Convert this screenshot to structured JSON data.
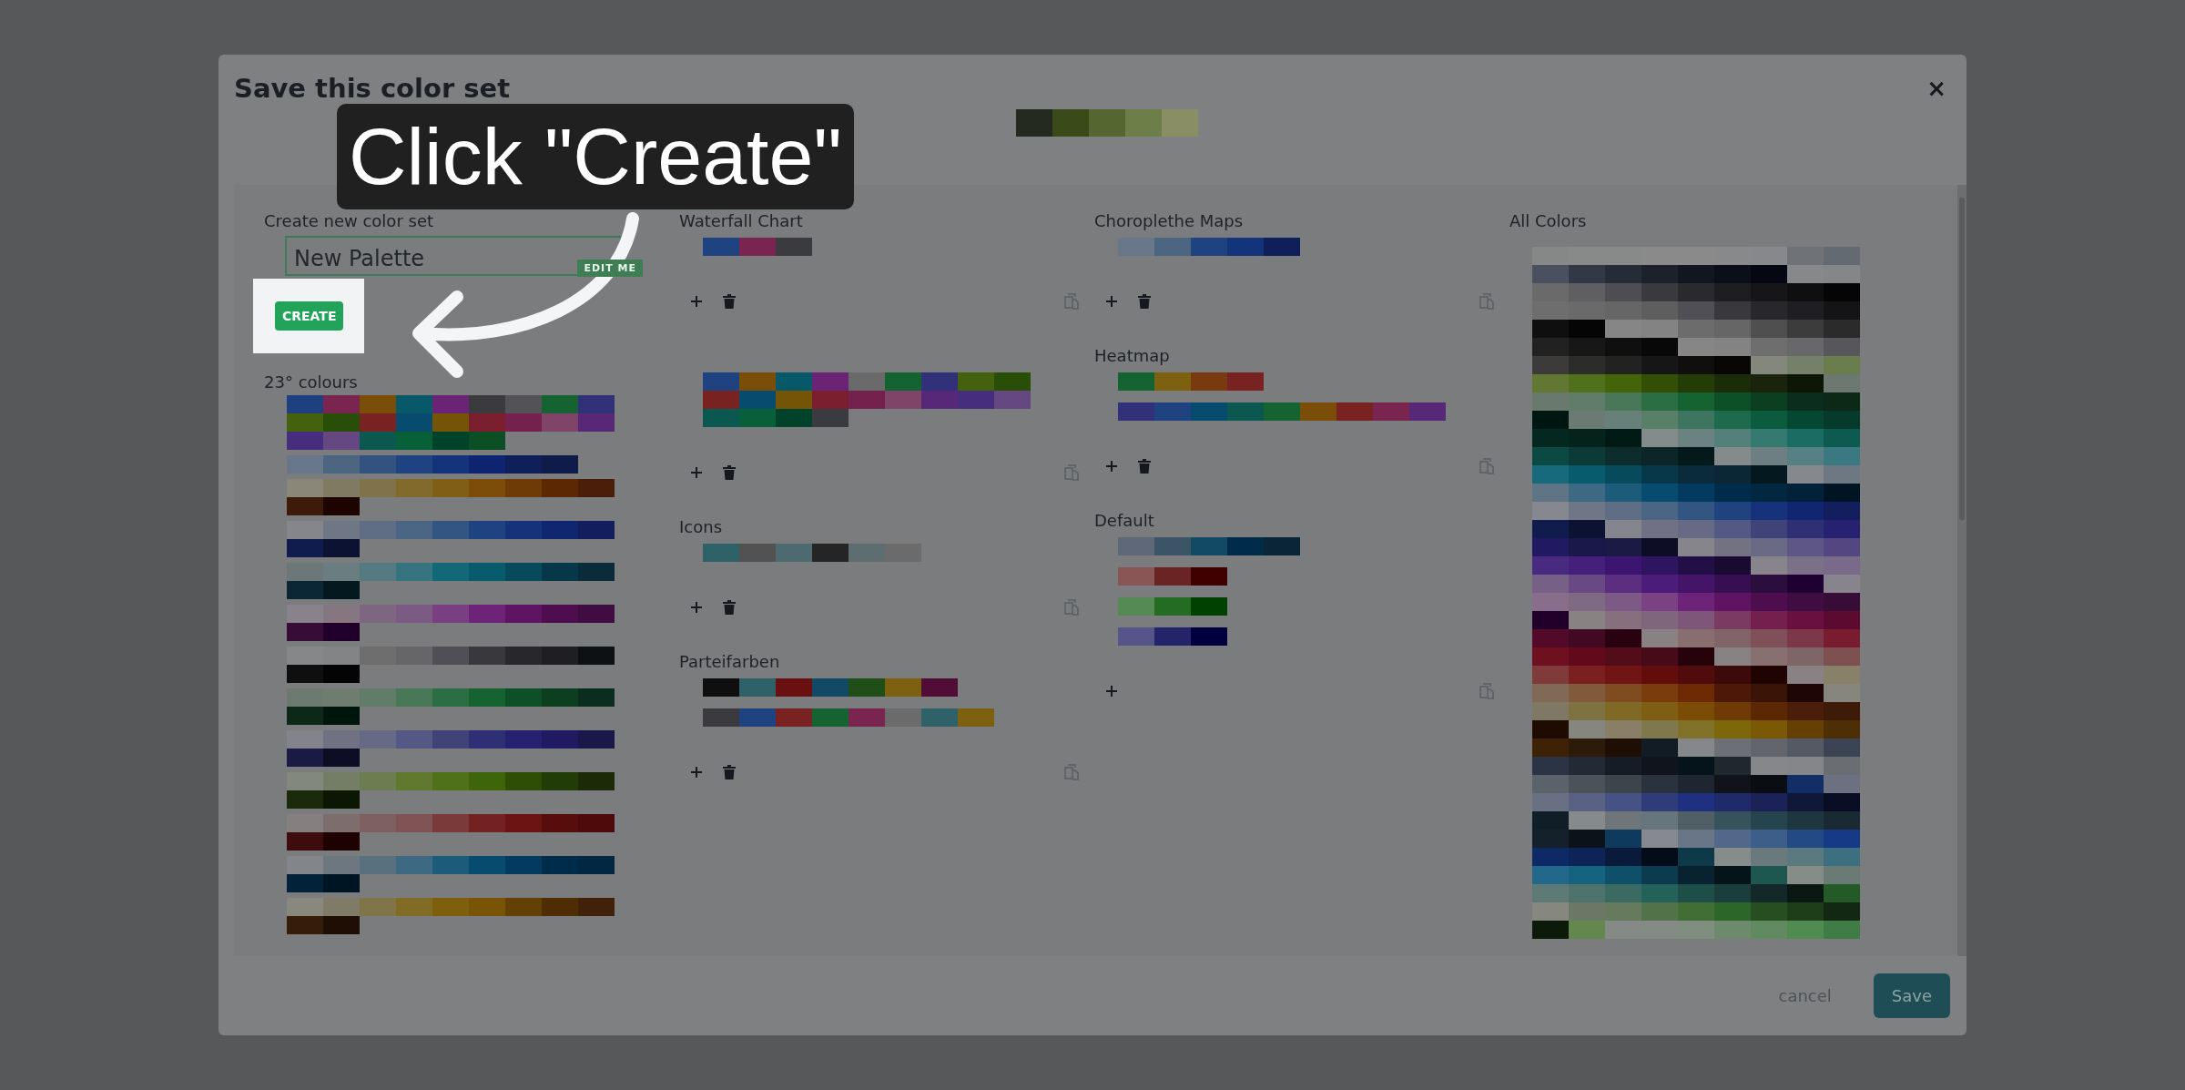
{
  "dialog": {
    "title": "Save this color set",
    "close": "×",
    "preview": [
      {
        "color": "#252a20"
      },
      {
        "color": "#3a4a18"
      },
      {
        "color": "#566630"
      },
      {
        "color": "#6e7e48"
      },
      {
        "color": "#8a8e64"
      }
    ]
  },
  "callout": {
    "text": "Click \"Create\""
  },
  "create_panel": {
    "label": "Create new color set",
    "name_value": "New Palette",
    "edit_tag": "EDIT ME",
    "create_button": "CREATE"
  },
  "preset_groups": {
    "title": "23° colours",
    "palettes": [
      [
        {
          "color": "#1f4080"
        },
        {
          "color": "#7a2450"
        },
        {
          "color": "#7a4e08"
        },
        {
          "color": "#075868"
        },
        {
          "color": "#6b2376"
        },
        {
          "color": "#3b3a3f"
        },
        {
          "color": "#525257"
        },
        {
          "color": "#146330"
        },
        {
          "color": "#31317a"
        },
        {
          "color": "#44620e"
        },
        {
          "color": "#284e07"
        },
        {
          "color": "#792222"
        },
        {
          "color": "#074b6f"
        },
        {
          "color": "#745507"
        },
        {
          "color": "#7b1f2e"
        },
        {
          "color": "#75214d"
        },
        {
          "color": "#804468"
        },
        {
          "color": "#572878"
        },
        {
          "color": "#472d7d"
        },
        {
          "color": "#654882"
        },
        {
          "color": "#0a5850"
        },
        {
          "color": "#086038"
        },
        {
          "color": "#00432a"
        },
        {
          "color": "#0c4f25"
        }
      ],
      [
        {
          "color": "#687789"
        },
        {
          "color": "#4c6581"
        },
        {
          "color": "#325280"
        },
        {
          "color": "#1f4381"
        },
        {
          "color": "#13337b"
        },
        {
          "color": "#0f2470"
        },
        {
          "color": "#0f1f5a"
        },
        {
          "color": "#0f1b48"
        }
      ],
      [
        {
          "color": "#8a8779"
        },
        {
          "color": "#7f7a62"
        },
        {
          "color": "#80734a"
        },
        {
          "color": "#816a2c"
        },
        {
          "color": "#7f5f16"
        },
        {
          "color": "#7c4d08"
        },
        {
          "color": "#6e3a06"
        },
        {
          "color": "#5c2804"
        },
        {
          "color": "#4a1e08"
        },
        {
          "color": "#3e1a08"
        },
        {
          "color": "#1e0400"
        }
      ],
      [
        {
          "color": "#84868c"
        },
        {
          "color": "#6f7786"
        },
        {
          "color": "#5f6e85"
        },
        {
          "color": "#4b6585"
        },
        {
          "color": "#335581"
        },
        {
          "color": "#1f4381"
        },
        {
          "color": "#15327b"
        },
        {
          "color": "#102670"
        },
        {
          "color": "#121e5e"
        },
        {
          "color": "#0f1c4d"
        },
        {
          "color": "#0c1231"
        }
      ],
      [
        {
          "color": "#6c7878"
        },
        {
          "color": "#6a7d80"
        },
        {
          "color": "#537b81"
        },
        {
          "color": "#367580"
        },
        {
          "color": "#136877"
        },
        {
          "color": "#075b6c"
        },
        {
          "color": "#064a5b"
        },
        {
          "color": "#07384a"
        },
        {
          "color": "#0a2b3a"
        },
        {
          "color": "#0b2635"
        },
        {
          "color": "#041820"
        }
      ],
      [
        {
          "color": "#87828c"
        },
        {
          "color": "#86767f"
        },
        {
          "color": "#7f6680"
        },
        {
          "color": "#7b5a84"
        },
        {
          "color": "#793f80"
        },
        {
          "color": "#6d2378"
        },
        {
          "color": "#5e1463"
        },
        {
          "color": "#4d0d4f"
        },
        {
          "color": "#3f0d41"
        },
        {
          "color": "#370c37"
        },
        {
          "color": "#20002a"
        }
      ],
      [
        {
          "color": "#868788"
        },
        {
          "color": "#838485"
        },
        {
          "color": "#6e6e6e"
        },
        {
          "color": "#666668"
        },
        {
          "color": "#4f4f55"
        },
        {
          "color": "#38383d"
        },
        {
          "color": "#28282c"
        },
        {
          "color": "#1f1f23"
        },
        {
          "color": "#0e1114"
        },
        {
          "color": "#0f0f0f"
        },
        {
          "color": "#040404"
        }
      ],
      [
        {
          "color": "#6c7a70"
        },
        {
          "color": "#6f7d70"
        },
        {
          "color": "#617d6a"
        },
        {
          "color": "#487858"
        },
        {
          "color": "#2b6e44"
        },
        {
          "color": "#146330"
        },
        {
          "color": "#0d4f26"
        },
        {
          "color": "#0c3f1f"
        },
        {
          "color": "#0b2d1d"
        },
        {
          "color": "#0c2816"
        },
        {
          "color": "#00160c"
        }
      ],
      [
        {
          "color": "#83838b"
        },
        {
          "color": "#707283"
        },
        {
          "color": "#666a85"
        },
        {
          "color": "#535984"
        },
        {
          "color": "#3f4378"
        },
        {
          "color": "#2f2f75"
        },
        {
          "color": "#262170"
        },
        {
          "color": "#211a63"
        },
        {
          "color": "#1a184a"
        },
        {
          "color": "#1a1a45"
        },
        {
          "color": "#0d0e26"
        }
      ],
      [
        {
          "color": "#83887e"
        },
        {
          "color": "#747e66"
        },
        {
          "color": "#6c7d51"
        },
        {
          "color": "#61792f"
        },
        {
          "color": "#4f7119"
        },
        {
          "color": "#3e6509"
        },
        {
          "color": "#2f4e05"
        },
        {
          "color": "#213c06"
        },
        {
          "color": "#1c2a07"
        },
        {
          "color": "#1c2a0c"
        },
        {
          "color": "#0c1703"
        }
      ],
      [
        {
          "color": "#867f7f"
        },
        {
          "color": "#7e6d6d"
        },
        {
          "color": "#7e6060"
        },
        {
          "color": "#805454"
        },
        {
          "color": "#7b3a3a"
        },
        {
          "color": "#742121"
        },
        {
          "color": "#6b1414"
        },
        {
          "color": "#580d0d"
        },
        {
          "color": "#4e0a0a"
        },
        {
          "color": "#3e0c0c"
        },
        {
          "color": "#1e0202"
        }
      ],
      [
        {
          "color": "#82868a"
        },
        {
          "color": "#6d7780"
        },
        {
          "color": "#59707e"
        },
        {
          "color": "#3d6a82"
        },
        {
          "color": "#1d5b7b"
        },
        {
          "color": "#074b6f"
        },
        {
          "color": "#033a60"
        },
        {
          "color": "#002c4c"
        },
        {
          "color": "#012840"
        },
        {
          "color": "#022239"
        },
        {
          "color": "#001524"
        }
      ],
      [
        {
          "color": "#89887f"
        },
        {
          "color": "#7f7b66"
        },
        {
          "color": "#807548"
        },
        {
          "color": "#806c24"
        },
        {
          "color": "#7d5f0c"
        },
        {
          "color": "#795407"
        },
        {
          "color": "#634104"
        },
        {
          "color": "#4e2d02"
        },
        {
          "color": "#42210a"
        },
        {
          "color": "#351d0a"
        },
        {
          "color": "#1f0e04"
        }
      ]
    ]
  },
  "columns": [
    {
      "sets": [
        {
          "name": "Waterfall Chart",
          "deletable": true,
          "palettes": [
            [
              {
                "color": "#1f4381"
              },
              {
                "color": "#7a2450"
              },
              {
                "color": "#3b3a3f"
              }
            ]
          ]
        },
        {
          "deletable": true,
          "palettes": [
            [
              {
                "color": "#1f4381"
              },
              {
                "color": "#7a4e08"
              },
              {
                "color": "#075868"
              },
              {
                "color": "#6b2376"
              },
              {
                "color": "#6a6a6a"
              },
              {
                "color": "#146330"
              },
              {
                "color": "#31317a"
              },
              {
                "color": "#44620e"
              },
              {
                "color": "#284e07"
              },
              {
                "color": "#792222"
              },
              {
                "color": "#074b6f"
              },
              {
                "color": "#745507"
              },
              {
                "color": "#7b1f2e"
              },
              {
                "color": "#75214d"
              },
              {
                "color": "#804468"
              },
              {
                "color": "#572878"
              },
              {
                "color": "#472d7d"
              },
              {
                "color": "#654882"
              },
              {
                "color": "#0a5850"
              },
              {
                "color": "#086038"
              },
              {
                "color": "#00432a"
              },
              {
                "color": "#3b3a3f"
              }
            ]
          ]
        },
        {
          "name": "Icons",
          "deletable": true,
          "palettes": [
            [
              {
                "color": "#2f6169"
              },
              {
                "color": "#525252"
              },
              {
                "color": "#4d6a70"
              },
              {
                "color": "#252525"
              },
              {
                "color": "#5e6d70"
              },
              {
                "color": "#6b6b6b"
              }
            ]
          ]
        },
        {
          "name": "Parteifarben",
          "deletable": true,
          "palettes": [
            [
              {
                "color": "#0f0f0f"
              },
              {
                "color": "#2f6169"
              },
              {
                "color": "#6b1010"
              },
              {
                "color": "#124a66"
              },
              {
                "color": "#1f4f16"
              },
              {
                "color": "#7d6110"
              },
              {
                "color": "#520d36"
              }
            ],
            [
              {
                "color": "#3b3a3f"
              },
              {
                "color": "#1f4381"
              },
              {
                "color": "#792222"
              },
              {
                "color": "#146330"
              },
              {
                "color": "#7a2450"
              },
              {
                "color": "#6b6b6b"
              },
              {
                "color": "#2f6169"
              },
              {
                "color": "#7d6110"
              }
            ]
          ]
        }
      ]
    },
    {
      "sets": [
        {
          "name": "Choroplethe Maps",
          "deletable": true,
          "palettes": [
            [
              {
                "color": "#687789"
              },
              {
                "color": "#4c6581"
              },
              {
                "color": "#1f4381"
              },
              {
                "color": "#13337b"
              },
              {
                "color": "#0f1f5a"
              }
            ]
          ]
        },
        {
          "name": "Heatmap",
          "deletable": true,
          "palettes": [
            [
              {
                "color": "#146330"
              },
              {
                "color": "#7d6110"
              },
              {
                "color": "#7a3a10"
              },
              {
                "color": "#792222"
              }
            ],
            [
              {
                "color": "#31317a"
              },
              {
                "color": "#1f4381"
              },
              {
                "color": "#074b6f"
              },
              {
                "color": "#0a5850"
              },
              {
                "color": "#146330"
              },
              {
                "color": "#7a4e08"
              },
              {
                "color": "#792222"
              },
              {
                "color": "#7a2450"
              },
              {
                "color": "#572878"
              }
            ]
          ]
        },
        {
          "name": "Default",
          "deletable": false,
          "palettes": [
            [
              {
                "color": "#5e6878"
              },
              {
                "color": "#3b5566"
              },
              {
                "color": "#134a63"
              },
              {
                "color": "#002c4a"
              },
              {
                "color": "#0a2438"
              }
            ],
            [
              {
                "color": "#8a5555"
              },
              {
                "color": "#6b2424"
              },
              {
                "color": "#400000"
              }
            ],
            [
              {
                "color": "#558a55"
              },
              {
                "color": "#246b24"
              },
              {
                "color": "#004000"
              }
            ],
            [
              {
                "color": "#55558a"
              },
              {
                "color": "#24246b"
              },
              {
                "color": "#000040"
              }
            ]
          ]
        }
      ]
    }
  ],
  "all_colors": {
    "title": "All Colors",
    "colors": [
      {
        "color": "#868887"
      },
      {
        "color": "#878a88"
      },
      {
        "color": "#888a89"
      },
      {
        "color": "#898a89"
      },
      {
        "color": "#8a8a8a"
      },
      {
        "color": "#87898a"
      },
      {
        "color": "#86888b"
      },
      {
        "color": "#6f7378"
      },
      {
        "color": "#646a72"
      },
      {
        "color": "#4b5060"
      },
      {
        "color": "#333846"
      },
      {
        "color": "#262b38"
      },
      {
        "color": "#1d212c"
      },
      {
        "color": "#121620"
      },
      {
        "color": "#0b0f1a"
      },
      {
        "color": "#050812"
      },
      {
        "color": "#878889"
      },
      {
        "color": "#858687"
      },
      {
        "color": "#6a6a6a"
      },
      {
        "color": "#5f5f61"
      },
      {
        "color": "#4e4e52"
      },
      {
        "color": "#3a393e"
      },
      {
        "color": "#2a292e"
      },
      {
        "color": "#1e1e22"
      },
      {
        "color": "#161618"
      },
      {
        "color": "#0f0f0f"
      },
      {
        "color": "#050505"
      },
      {
        "color": "#6e6e6e"
      },
      {
        "color": "#6a6a6a"
      },
      {
        "color": "#666666"
      },
      {
        "color": "#5e5e5f"
      },
      {
        "color": "#4f4f55"
      },
      {
        "color": "#38383d"
      },
      {
        "color": "#28282c"
      },
      {
        "color": "#1f1f23"
      },
      {
        "color": "#141416"
      },
      {
        "color": "#0f0f0f"
      },
      {
        "color": "#050505"
      },
      {
        "color": "#868687"
      },
      {
        "color": "#838384"
      },
      {
        "color": "#6c6c6c"
      },
      {
        "color": "#666666"
      },
      {
        "color": "#4f4f4f"
      },
      {
        "color": "#3c3c3c"
      },
      {
        "color": "#2b2b2b"
      },
      {
        "color": "#212121"
      },
      {
        "color": "#171717"
      },
      {
        "color": "#0f0f0f"
      },
      {
        "color": "#080808"
      },
      {
        "color": "#868686"
      },
      {
        "color": "#838383"
      },
      {
        "color": "#6e6e6e"
      },
      {
        "color": "#68686a"
      },
      {
        "color": "#57565a"
      },
      {
        "color": "#3c3b3a"
      },
      {
        "color": "#2c2c2a"
      },
      {
        "color": "#222221"
      },
      {
        "color": "#171616"
      },
      {
        "color": "#100f0e"
      },
      {
        "color": "#080706"
      },
      {
        "color": "#84887c"
      },
      {
        "color": "#75806a"
      },
      {
        "color": "#6a7d4c"
      },
      {
        "color": "#627832"
      },
      {
        "color": "#50701c"
      },
      {
        "color": "#436408"
      },
      {
        "color": "#344f05"
      },
      {
        "color": "#243c06"
      },
      {
        "color": "#1b2c08"
      },
      {
        "color": "#1a230b"
      },
      {
        "color": "#0e1605"
      },
      {
        "color": "#6c7870"
      },
      {
        "color": "#6a796d"
      },
      {
        "color": "#617d6a"
      },
      {
        "color": "#487858"
      },
      {
        "color": "#2b6e44"
      },
      {
        "color": "#146330"
      },
      {
        "color": "#0d4f26"
      },
      {
        "color": "#0c3f1f"
      },
      {
        "color": "#0b2d1d"
      },
      {
        "color": "#0c2816"
      },
      {
        "color": "#001610"
      },
      {
        "color": "#6c7a74"
      },
      {
        "color": "#68807a"
      },
      {
        "color": "#588069"
      },
      {
        "color": "#3d7560"
      },
      {
        "color": "#1e6a4c"
      },
      {
        "color": "#0b5b3e"
      },
      {
        "color": "#044832"
      },
      {
        "color": "#053a2c"
      },
      {
        "color": "#04281f"
      },
      {
        "color": "#03231b"
      },
      {
        "color": "#021a15"
      },
      {
        "color": "#848b8b"
      },
      {
        "color": "#6b8380"
      },
      {
        "color": "#538078"
      },
      {
        "color": "#357a70"
      },
      {
        "color": "#1b6c62"
      },
      {
        "color": "#0d5a50"
      },
      {
        "color": "#0a4a42"
      },
      {
        "color": "#0c3a36"
      },
      {
        "color": "#0c2d2b"
      },
      {
        "color": "#0c2526"
      },
      {
        "color": "#041a1a"
      },
      {
        "color": "#858a8c"
      },
      {
        "color": "#6d7f82"
      },
      {
        "color": "#578085"
      },
      {
        "color": "#3a7882"
      },
      {
        "color": "#166a7c"
      },
      {
        "color": "#075b6c"
      },
      {
        "color": "#064a5b"
      },
      {
        "color": "#07384a"
      },
      {
        "color": "#0a2b3a"
      },
      {
        "color": "#0b2635"
      },
      {
        "color": "#041820"
      },
      {
        "color": "#85888d"
      },
      {
        "color": "#6d7882"
      },
      {
        "color": "#5f7586"
      },
      {
        "color": "#3d6a82"
      },
      {
        "color": "#1d5b7b"
      },
      {
        "color": "#074b6f"
      },
      {
        "color": "#033a60"
      },
      {
        "color": "#002c4c"
      },
      {
        "color": "#012840"
      },
      {
        "color": "#022239"
      },
      {
        "color": "#001524"
      },
      {
        "color": "#85888e"
      },
      {
        "color": "#6f7786"
      },
      {
        "color": "#5f6e85"
      },
      {
        "color": "#4b6585"
      },
      {
        "color": "#335581"
      },
      {
        "color": "#1f4381"
      },
      {
        "color": "#15327b"
      },
      {
        "color": "#102670"
      },
      {
        "color": "#121e5e"
      },
      {
        "color": "#0f1c4d"
      },
      {
        "color": "#0c1231"
      },
      {
        "color": "#85868d"
      },
      {
        "color": "#707283"
      },
      {
        "color": "#666a85"
      },
      {
        "color": "#535984"
      },
      {
        "color": "#3f4378"
      },
      {
        "color": "#2f2f75"
      },
      {
        "color": "#262170"
      },
      {
        "color": "#211a63"
      },
      {
        "color": "#1a184a"
      },
      {
        "color": "#1a1a45"
      },
      {
        "color": "#0d0e26"
      },
      {
        "color": "#85858b"
      },
      {
        "color": "#727282"
      },
      {
        "color": "#6a6a85"
      },
      {
        "color": "#5e5785"
      },
      {
        "color": "#544680"
      },
      {
        "color": "#482a80"
      },
      {
        "color": "#44207a"
      },
      {
        "color": "#3c1570"
      },
      {
        "color": "#2f1462"
      },
      {
        "color": "#230f48"
      },
      {
        "color": "#1a0a32"
      },
      {
        "color": "#87848b"
      },
      {
        "color": "#7a7088"
      },
      {
        "color": "#7a6a8a"
      },
      {
        "color": "#766086"
      },
      {
        "color": "#6a4884"
      },
      {
        "color": "#5c2e80"
      },
      {
        "color": "#4c1c7a"
      },
      {
        "color": "#431467"
      },
      {
        "color": "#360f52"
      },
      {
        "color": "#2c0e3e"
      },
      {
        "color": "#1e0032"
      },
      {
        "color": "#88848d"
      },
      {
        "color": "#886e8a"
      },
      {
        "color": "#7f6a84"
      },
      {
        "color": "#7d5a86"
      },
      {
        "color": "#7a4282"
      },
      {
        "color": "#6d2378"
      },
      {
        "color": "#5e1463"
      },
      {
        "color": "#4d0d4f"
      },
      {
        "color": "#3f0d41"
      },
      {
        "color": "#370c37"
      },
      {
        "color": "#20002a"
      },
      {
        "color": "#888282"
      },
      {
        "color": "#86707e"
      },
      {
        "color": "#7f667c"
      },
      {
        "color": "#7e567a"
      },
      {
        "color": "#7a3a62"
      },
      {
        "color": "#741f4e"
      },
      {
        "color": "#6a1040"
      },
      {
        "color": "#5c0a30"
      },
      {
        "color": "#520a28"
      },
      {
        "color": "#420a22"
      },
      {
        "color": "#28020e"
      },
      {
        "color": "#888283"
      },
      {
        "color": "#886e6e"
      },
      {
        "color": "#806468"
      },
      {
        "color": "#805058"
      },
      {
        "color": "#7c3848"
      },
      {
        "color": "#7a1c30"
      },
      {
        "color": "#6e1020"
      },
      {
        "color": "#620a1c"
      },
      {
        "color": "#520c1a"
      },
      {
        "color": "#460a18"
      },
      {
        "color": "#26020a"
      },
      {
        "color": "#888284"
      },
      {
        "color": "#887070"
      },
      {
        "color": "#7e6666"
      },
      {
        "color": "#7e5050"
      },
      {
        "color": "#803a3a"
      },
      {
        "color": "#7a2020"
      },
      {
        "color": "#701414"
      },
      {
        "color": "#620c0c"
      },
      {
        "color": "#500c0c"
      },
      {
        "color": "#3c0a0a"
      },
      {
        "color": "#200402"
      },
      {
        "color": "#888285"
      },
      {
        "color": "#888068"
      },
      {
        "color": "#806a56"
      },
      {
        "color": "#805a3a"
      },
      {
        "color": "#7e4c20"
      },
      {
        "color": "#7a3c0c"
      },
      {
        "color": "#6e2a04"
      },
      {
        "color": "#4e1808"
      },
      {
        "color": "#3a1406"
      },
      {
        "color": "#1e0604"
      },
      {
        "color": "#86867c"
      },
      {
        "color": "#7e7864"
      },
      {
        "color": "#7e7240"
      },
      {
        "color": "#7e6a24"
      },
      {
        "color": "#7e5e12"
      },
      {
        "color": "#7a4c06"
      },
      {
        "color": "#6e3a06"
      },
      {
        "color": "#5c2804"
      },
      {
        "color": "#4a1e08"
      },
      {
        "color": "#3e1a08"
      },
      {
        "color": "#1e0c00"
      },
      {
        "color": "#868680"
      },
      {
        "color": "#887f66"
      },
      {
        "color": "#7e784c"
      },
      {
        "color": "#807228"
      },
      {
        "color": "#7e660a"
      },
      {
        "color": "#7a5806"
      },
      {
        "color": "#644004"
      },
      {
        "color": "#4e2e04"
      },
      {
        "color": "#3e2206"
      },
      {
        "color": "#2e1a08"
      },
      {
        "color": "#1e0e04"
      },
      {
        "color": "#111c24"
      },
      {
        "color": "#86878a"
      },
      {
        "color": "#6c7074"
      },
      {
        "color": "#62666c"
      },
      {
        "color": "#545a64"
      },
      {
        "color": "#3a4454"
      },
      {
        "color": "#2a3444"
      },
      {
        "color": "#222a36"
      },
      {
        "color": "#161c26"
      },
      {
        "color": "#10141c"
      },
      {
        "color": "#04141a"
      },
      {
        "color": "#20282e"
      },
      {
        "color": "#86878a"
      },
      {
        "color": "#848689"
      },
      {
        "color": "#6a6e72"
      },
      {
        "color": "#5a626a"
      },
      {
        "color": "#4a525a"
      },
      {
        "color": "#3c444c"
      },
      {
        "color": "#2a323e"
      },
      {
        "color": "#1e2632"
      },
      {
        "color": "#101418"
      },
      {
        "color": "#0a0e12"
      },
      {
        "color": "#122e66"
      },
      {
        "color": "#6c7080"
      },
      {
        "color": "#6a7084"
      },
      {
        "color": "#5a6284"
      },
      {
        "color": "#465284"
      },
      {
        "color": "#2e3c7a"
      },
      {
        "color": "#203080"
      },
      {
        "color": "#1e2a6a"
      },
      {
        "color": "#1a2258"
      },
      {
        "color": "#10183a"
      },
      {
        "color": "#0a0e24"
      },
      {
        "color": "#101e28"
      },
      {
        "color": "#868a8c"
      },
      {
        "color": "#6e767a"
      },
      {
        "color": "#66767c"
      },
      {
        "color": "#505e66"
      },
      {
        "color": "#36525a"
      },
      {
        "color": "#26444e"
      },
      {
        "color": "#1e3640"
      },
      {
        "color": "#1a2a32"
      },
      {
        "color": "#14202a"
      },
      {
        "color": "#0a1418"
      },
      {
        "color": "#0e3a5e"
      },
      {
        "color": "#868a90"
      },
      {
        "color": "#687688"
      },
      {
        "color": "#52688a"
      },
      {
        "color": "#3e5e8a"
      },
      {
        "color": "#244a86"
      },
      {
        "color": "#163a86"
      },
      {
        "color": "#0e2a66"
      },
      {
        "color": "#0e2458"
      },
      {
        "color": "#0a1a3a"
      },
      {
        "color": "#040c1a"
      },
      {
        "color": "#0c3a48"
      },
      {
        "color": "#868c8c"
      },
      {
        "color": "#6a7a7c"
      },
      {
        "color": "#5a7a80"
      },
      {
        "color": "#3c7080"
      },
      {
        "color": "#22688a"
      },
      {
        "color": "#146480"
      },
      {
        "color": "#0e506a"
      },
      {
        "color": "#0c3a4e"
      },
      {
        "color": "#082230"
      },
      {
        "color": "#041418"
      },
      {
        "color": "#1e5650"
      },
      {
        "color": "#868c88"
      },
      {
        "color": "#6a7a74"
      },
      {
        "color": "#5e7a74"
      },
      {
        "color": "#4e726c"
      },
      {
        "color": "#3a6a62"
      },
      {
        "color": "#22625a"
      },
      {
        "color": "#1e4e48"
      },
      {
        "color": "#1a3e3c"
      },
      {
        "color": "#14282a"
      },
      {
        "color": "#0a1814"
      },
      {
        "color": "#245a28"
      },
      {
        "color": "#868880"
      },
      {
        "color": "#6c7866"
      },
      {
        "color": "#667a5e"
      },
      {
        "color": "#52724a"
      },
      {
        "color": "#406e34"
      },
      {
        "color": "#2c6628"
      },
      {
        "color": "#264e20"
      },
      {
        "color": "#1e3e1a"
      },
      {
        "color": "#122812"
      },
      {
        "color": "#0c1a0a"
      },
      {
        "color": "#62884e"
      },
      {
        "color": "#868a86"
      },
      {
        "color": "#848a84"
      },
      {
        "color": "#808e80"
      },
      {
        "color": "#6e8a6c"
      },
      {
        "color": "#628a60"
      },
      {
        "color": "#508c50"
      },
      {
        "color": "#407c46"
      }
    ]
  },
  "footer": {
    "cancel": "cancel",
    "save": "Save"
  }
}
